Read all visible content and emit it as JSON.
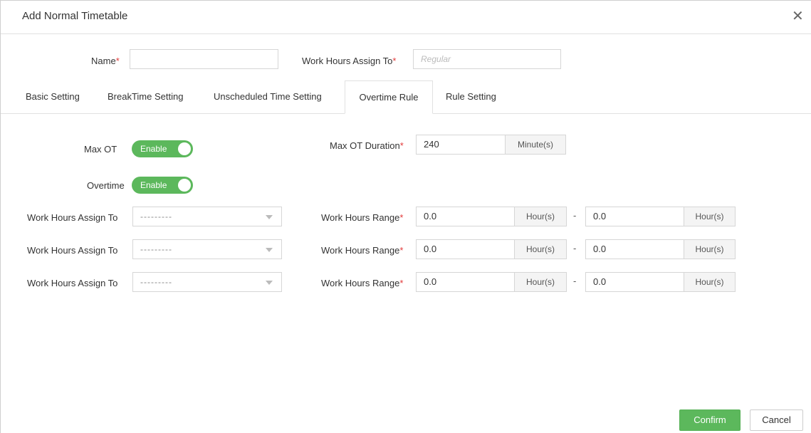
{
  "dialog": {
    "title": "Add Normal Timetable",
    "close_icon": "close-icon"
  },
  "form": {
    "name_label": "Name",
    "name_value": "",
    "assign_label": "Work Hours Assign To",
    "assign_placeholder": "Regular",
    "required_mark": "*"
  },
  "tabs": [
    {
      "label": "Basic Setting",
      "active": false
    },
    {
      "label": "BreakTime Setting",
      "active": false
    },
    {
      "label": "Unscheduled Time Setting",
      "active": false
    },
    {
      "label": "Overtime Rule",
      "active": true
    },
    {
      "label": "Rule Setting",
      "active": false
    }
  ],
  "overtime": {
    "max_ot_label": "Max OT",
    "max_ot_toggle": "Enable",
    "max_ot_duration_label": "Max OT Duration",
    "max_ot_duration_value": "240",
    "max_ot_duration_unit": "Minute(s)",
    "overtime_label": "Overtime",
    "overtime_toggle": "Enable",
    "rows": [
      {
        "assign_label": "Work Hours Assign To",
        "assign_value": "---------",
        "range_label": "Work Hours Range",
        "from": "0.0",
        "from_unit": "Hour(s)",
        "sep": "-",
        "to": "0.0",
        "to_unit": "Hour(s)"
      },
      {
        "assign_label": "Work Hours Assign To",
        "assign_value": "---------",
        "range_label": "Work Hours Range",
        "from": "0.0",
        "from_unit": "Hour(s)",
        "sep": "-",
        "to": "0.0",
        "to_unit": "Hour(s)"
      },
      {
        "assign_label": "Work Hours Assign To",
        "assign_value": "---------",
        "range_label": "Work Hours Range",
        "from": "0.0",
        "from_unit": "Hour(s)",
        "sep": "-",
        "to": "0.0",
        "to_unit": "Hour(s)"
      }
    ]
  },
  "footer": {
    "confirm_label": "Confirm",
    "cancel_label": "Cancel"
  },
  "colors": {
    "accent": "#5cb85c",
    "required": "#e23a3a"
  }
}
